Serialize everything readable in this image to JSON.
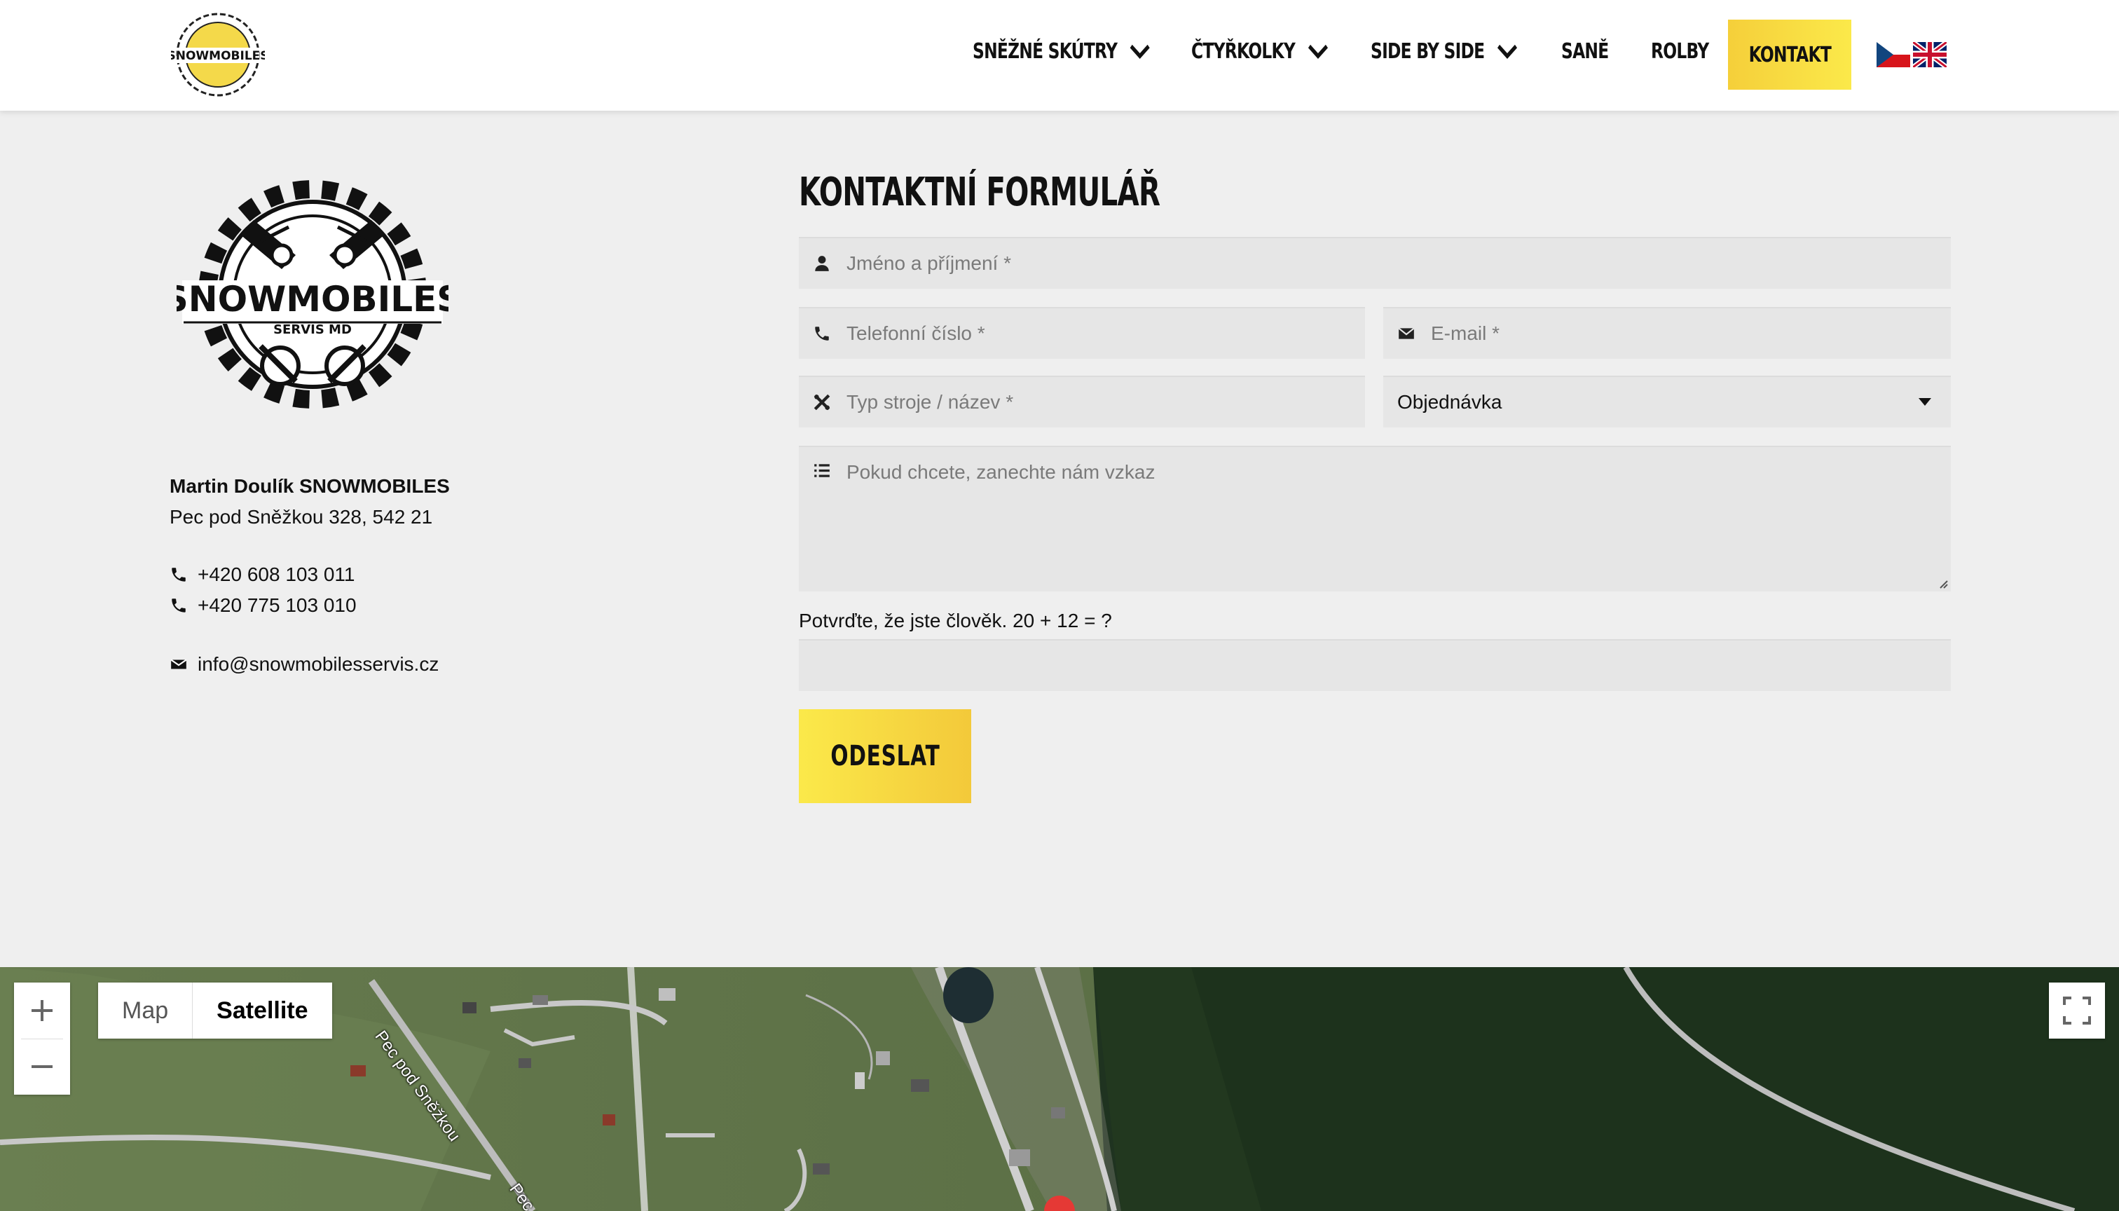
{
  "header": {
    "logo_alt": "SNOWMOBILES",
    "nav": [
      {
        "label": "SNĚŽNÉ SKÚTRY",
        "has_dropdown": true
      },
      {
        "label": "ČTYŘKOLKY",
        "has_dropdown": true
      },
      {
        "label": "SIDE BY SIDE",
        "has_dropdown": true
      },
      {
        "label": "SANĚ",
        "has_dropdown": false
      },
      {
        "label": "ROLBY",
        "has_dropdown": false
      },
      {
        "label": "KONTAKT",
        "active": true
      }
    ],
    "languages": [
      "cz-flag-icon",
      "uk-flag-icon"
    ]
  },
  "contact": {
    "logo_text": "SNOWMOBILES",
    "logo_subtext": "SERVIS MD",
    "company": "Martin Doulík SNOWMOBILES",
    "address": "Pec pod Sněžkou 328, 542 21",
    "phone1": "+420 608 103 011",
    "phone2": "+420 775 103 010",
    "email": "info@snowmobilesservis.cz"
  },
  "form": {
    "title": "KONTAKTNÍ FORMULÁŘ",
    "name_placeholder": "Jméno a příjmení *",
    "phone_placeholder": "Telefonní číslo *",
    "email_placeholder": "E-mail *",
    "machine_placeholder": "Typ stroje / název *",
    "select_value": "Objednávka",
    "message_placeholder": "Pokud chcete, zanechte nám vzkaz",
    "captcha_label": "Potvrďte, že jste člověk. 20 + 12 = ?",
    "captcha_value": "",
    "submit_label": "ODESLAT"
  },
  "map": {
    "map_label": "Map",
    "satellite_label": "Satellite",
    "selected": "Satellite",
    "road_label_1": "Pec pod Sněžkou",
    "road_label_2": "Pec p"
  },
  "colors": {
    "accent_yellow": "#fbe94a",
    "accent_yellow_dark": "#f3c93a",
    "background": "#efefef",
    "field_bg": "#e6e6e6"
  }
}
